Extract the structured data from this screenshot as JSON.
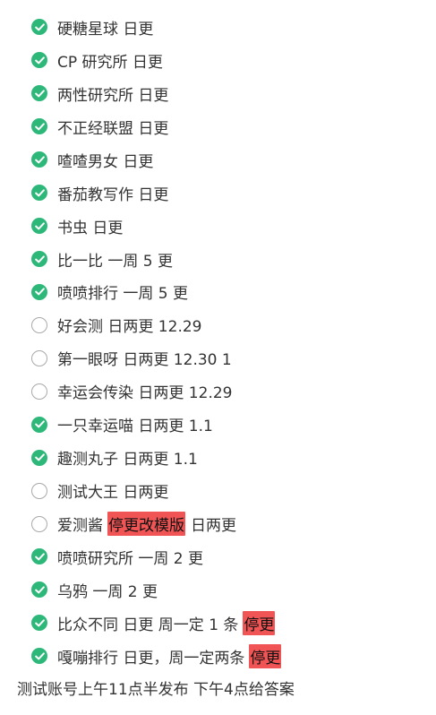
{
  "colors": {
    "check_done": "#2db87a",
    "check_todo_border": "#a9a9a9",
    "highlight": "#f05454",
    "text": "#333333"
  },
  "items": [
    {
      "done": true,
      "text": "硬糖星球 日更",
      "tag": "",
      "suffix": ""
    },
    {
      "done": true,
      "text": "CP 研究所 日更",
      "tag": "",
      "suffix": ""
    },
    {
      "done": true,
      "text": "两性研究所 日更",
      "tag": "",
      "suffix": ""
    },
    {
      "done": true,
      "text": "不正经联盟 日更",
      "tag": "",
      "suffix": ""
    },
    {
      "done": true,
      "text": "喳喳男女 日更",
      "tag": "",
      "suffix": ""
    },
    {
      "done": true,
      "text": "番茄教写作 日更",
      "tag": "",
      "suffix": ""
    },
    {
      "done": true,
      "text": "书虫 日更",
      "tag": "",
      "suffix": ""
    },
    {
      "done": true,
      "text": "比一比 一周 5 更",
      "tag": "",
      "suffix": ""
    },
    {
      "done": true,
      "text": "喷喷排行 一周 5 更",
      "tag": "",
      "suffix": ""
    },
    {
      "done": false,
      "text": "好会测 日两更 12.29",
      "tag": "",
      "suffix": ""
    },
    {
      "done": false,
      "text": "第一眼呀 日两更 12.30 1",
      "tag": "",
      "suffix": ""
    },
    {
      "done": false,
      "text": "幸运会传染 日两更 12.29",
      "tag": "",
      "suffix": ""
    },
    {
      "done": true,
      "text": "一只幸运喵 日两更 1.1",
      "tag": "",
      "suffix": ""
    },
    {
      "done": true,
      "text": "趣测丸子 日两更 1.1",
      "tag": "",
      "suffix": ""
    },
    {
      "done": false,
      "text": "测试大王 日两更",
      "tag": "",
      "suffix": ""
    },
    {
      "done": false,
      "text": "爱测酱",
      "tag": "停更改模版",
      "suffix": "日两更"
    },
    {
      "done": true,
      "text": "喷喷研究所 一周 2 更",
      "tag": "",
      "suffix": ""
    },
    {
      "done": true,
      "text": "乌鸦 一周 2 更",
      "tag": "",
      "suffix": ""
    },
    {
      "done": true,
      "text": "比众不同 日更 周一定 1 条",
      "tag": "停更",
      "suffix": ""
    },
    {
      "done": true,
      "text": "嘎嘣排行 日更，周一定两条",
      "tag": "停更",
      "suffix": ""
    }
  ],
  "footer": "测试账号上午11点半发布 下午4点给答案"
}
